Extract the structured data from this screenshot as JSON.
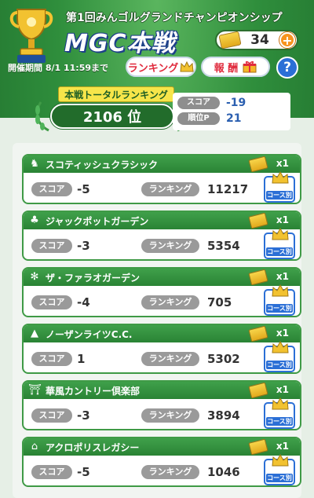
{
  "header": {
    "event_title": "第1回みんゴルグランドチャンピオンシップ",
    "mgc_title": "MGC本戦",
    "currency_value": "34",
    "plus_label": "+",
    "period_label": "開催期間 8/1 11:59まで",
    "ranking_button": "ランキング",
    "reward_button": "報 酬",
    "help_label": "?"
  },
  "total": {
    "label": "本戦トータルランキング",
    "rank": "2106 位",
    "score_label": "スコア",
    "score_value": "-19",
    "points_label": "順位P",
    "points_value": "21"
  },
  "labels": {
    "score": "スコア",
    "ranking": "ランキング",
    "course_button": "コース別"
  },
  "courses": [
    {
      "name": "スコティッシュクラシック",
      "icon": "lion-icon",
      "ticket": "x1",
      "score": "-5",
      "ranking": "11217"
    },
    {
      "name": "ジャックポットガーデン",
      "icon": "casino-icon",
      "ticket": "x1",
      "score": "-3",
      "ranking": "5354"
    },
    {
      "name": "ザ・ファラオガーデン",
      "icon": "palm-icon",
      "ticket": "x1",
      "score": "-4",
      "ranking": "705"
    },
    {
      "name": "ノーザンライツC.C.",
      "icon": "mountain-icon",
      "ticket": "x1",
      "score": "1",
      "ranking": "5302"
    },
    {
      "name": "華風カントリー倶楽部",
      "icon": "pagoda-icon",
      "ticket": "x1",
      "score": "-3",
      "ranking": "3894"
    },
    {
      "name": "アクロポリスレガシー",
      "icon": "temple-icon",
      "ticket": "x1",
      "score": "-5",
      "ranking": "1046"
    }
  ],
  "colors": {
    "green": "#2a8335",
    "accent_red": "#e02b3d",
    "blue": "#2b6fd6",
    "gold": "#f7d54a"
  }
}
